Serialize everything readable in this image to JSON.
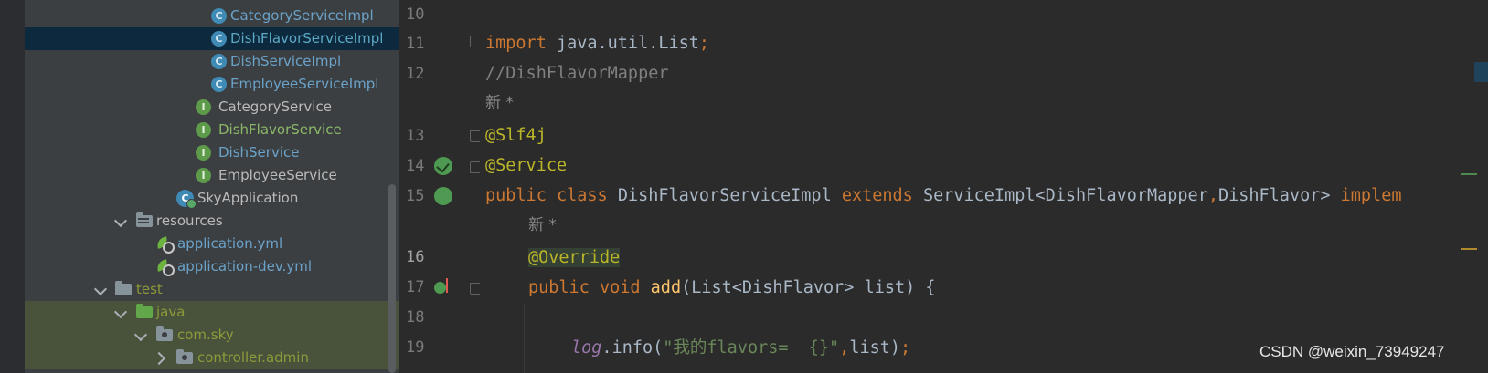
{
  "tree": {
    "items": [
      {
        "label": "CategoryServiceImpl",
        "icon": "class-icon",
        "glyph": "C"
      },
      {
        "label": "DishFlavorServiceImpl",
        "icon": "class-icon",
        "glyph": "C"
      },
      {
        "label": "DishServiceImpl",
        "icon": "class-icon",
        "glyph": "C"
      },
      {
        "label": "EmployeeServiceImpl",
        "icon": "class-icon",
        "glyph": "C"
      },
      {
        "label": "CategoryService",
        "icon": "interface-icon",
        "glyph": "I"
      },
      {
        "label": "DishFlavorService",
        "icon": "interface-icon",
        "glyph": "I"
      },
      {
        "label": "DishService",
        "icon": "interface-icon",
        "glyph": "I"
      },
      {
        "label": "EmployeeService",
        "icon": "interface-icon",
        "glyph": "I"
      },
      {
        "label": "SkyApplication",
        "icon": "spring-boot-app-icon",
        "glyph": "C"
      },
      {
        "label": "resources",
        "icon": "resources-folder-icon"
      },
      {
        "label": "application.yml",
        "icon": "yaml-config-icon"
      },
      {
        "label": "application-dev.yml",
        "icon": "yaml-config-icon"
      },
      {
        "label": "test",
        "icon": "folder-icon"
      },
      {
        "label": "java",
        "icon": "source-folder-icon"
      },
      {
        "label": "com.sky",
        "icon": "package-icon"
      },
      {
        "label": "controller.admin",
        "icon": "package-icon"
      }
    ]
  },
  "editor": {
    "line_numbers": [
      "10",
      "11",
      "12",
      "13",
      "14",
      "15",
      "16",
      "17",
      "18",
      "19"
    ],
    "code": {
      "l11_kw": "import",
      "l11_rest": " java.util.List",
      "l11_semi": ";",
      "l12": "//DishFlavorMapper",
      "hint": "新 *",
      "l13": "@Slf4j",
      "l14": "@Service",
      "l15_kw1": "public",
      "l15_kw2": "class",
      "l15_name": "DishFlavorServiceImpl",
      "l15_kw3": "extends",
      "l15_type": "ServiceImpl<DishFlavorMapper",
      "l15_comma": ",",
      "l15_type2": "DishFlavor> ",
      "l15_kw4": "implem",
      "l16": "@Override",
      "l17_kw1": "public",
      "l17_kw2": "void",
      "l17_fn": "add",
      "l17_rest": "(List<DishFlavor> list) {",
      "l19_log": "log",
      "l19_call": ".info(",
      "l19_str": "\"我的flavors=  {}\"",
      "l19_comma": ",",
      "l19_arg": "list)",
      "l19_semi": ";"
    }
  },
  "watermark": "CSDN @weixin_73949247",
  "colors": {
    "keyword": "#cc7832",
    "annotation": "#bbb529",
    "string": "#6a8759",
    "function": "#ffc66d",
    "comment": "#808080"
  }
}
